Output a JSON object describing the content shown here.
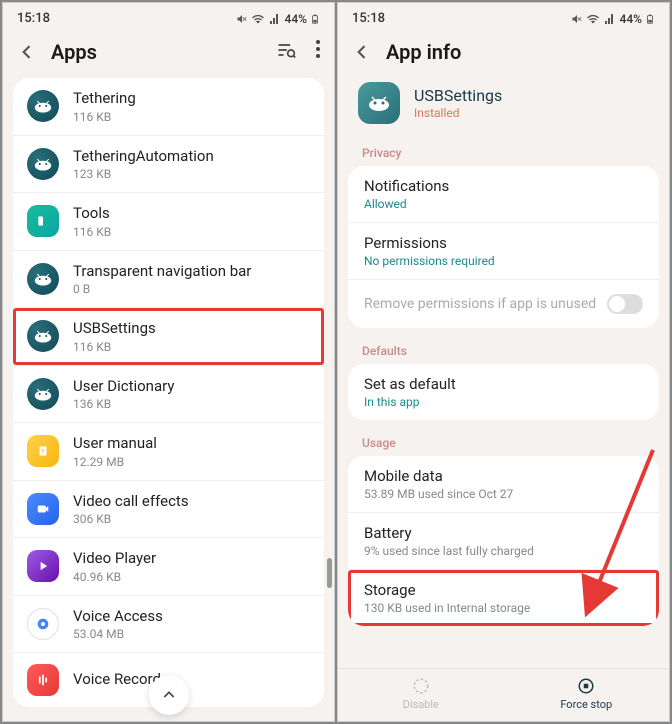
{
  "status": {
    "time": "15:18",
    "battery": "44%"
  },
  "left": {
    "title": "Apps",
    "apps": [
      {
        "name": "Tethering",
        "size": "116 KB",
        "iconClass": "teal"
      },
      {
        "name": "TetheringAutomation",
        "size": "123 KB",
        "iconClass": "teal"
      },
      {
        "name": "Tools",
        "size": "116 KB",
        "iconClass": "teal-light"
      },
      {
        "name": "Transparent navigation bar",
        "size": "0 B",
        "iconClass": "teal"
      },
      {
        "name": "USBSettings",
        "size": "116 KB",
        "iconClass": "teal",
        "highlight": true
      },
      {
        "name": "User Dictionary",
        "size": "136 KB",
        "iconClass": "teal"
      },
      {
        "name": "User manual",
        "size": "12.29 MB",
        "iconClass": "yellow"
      },
      {
        "name": "Video call effects",
        "size": "306 KB",
        "iconClass": "blue"
      },
      {
        "name": "Video Player",
        "size": "40.96 KB",
        "iconClass": "purple"
      },
      {
        "name": "Voice Access",
        "size": "53.04 MB",
        "iconClass": "white"
      },
      {
        "name": "Voice Recorder",
        "size": "",
        "iconClass": "red"
      }
    ]
  },
  "right": {
    "title": "App info",
    "app": {
      "name": "USBSettings",
      "status": "Installed"
    },
    "sections": {
      "privacy": "Privacy",
      "defaults": "Defaults",
      "usage": "Usage"
    },
    "notifications": {
      "title": "Notifications",
      "sub": "Allowed"
    },
    "permissions": {
      "title": "Permissions",
      "sub": "No permissions required"
    },
    "removeUnused": "Remove permissions if app is unused",
    "setDefault": {
      "title": "Set as default",
      "sub": "In this app"
    },
    "mobileData": {
      "title": "Mobile data",
      "sub": "53.89 MB used since Oct 27"
    },
    "battery": {
      "title": "Battery",
      "sub": "9% used since last fully charged"
    },
    "storage": {
      "title": "Storage",
      "sub": "130 KB used in Internal storage"
    },
    "actions": {
      "disable": "Disable",
      "forceStop": "Force stop"
    }
  }
}
